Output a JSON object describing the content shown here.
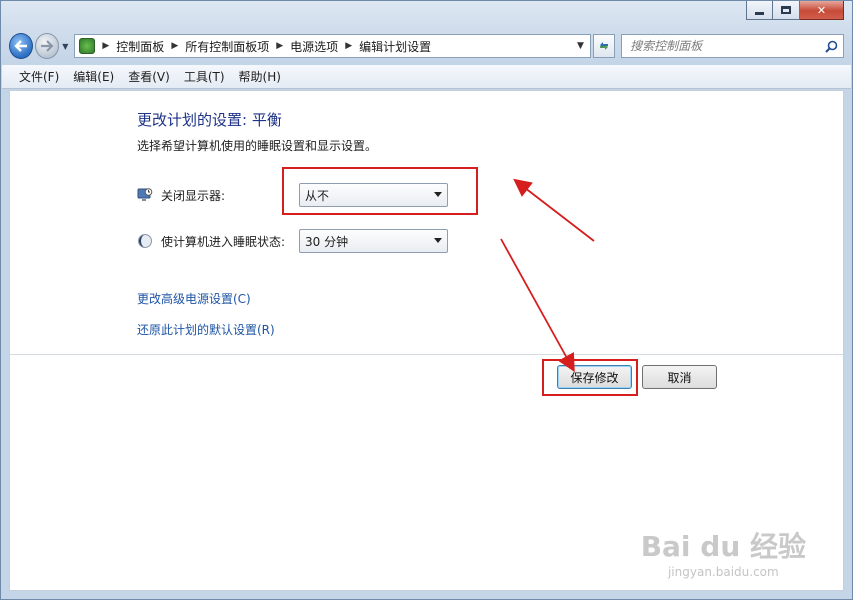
{
  "window": {
    "minimize_label": "",
    "maximize_label": "",
    "close_label": "✕"
  },
  "address_bar": {
    "breadcrumbs": [
      "控制面板",
      "所有控制面板项",
      "电源选项",
      "编辑计划设置"
    ]
  },
  "search": {
    "placeholder": "搜索控制面板"
  },
  "menu": {
    "items": [
      "文件(F)",
      "编辑(E)",
      "查看(V)",
      "工具(T)",
      "帮助(H)"
    ]
  },
  "main": {
    "title": "更改计划的设置: 平衡",
    "description": "选择希望计算机使用的睡眠设置和显示设置。",
    "settings": [
      {
        "label": "关闭显示器:",
        "value": "从不",
        "icon": "display-off-icon"
      },
      {
        "label": "使计算机进入睡眠状态:",
        "value": "30 分钟",
        "icon": "sleep-moon-icon"
      }
    ],
    "links": {
      "advanced": "更改高级电源设置(C)",
      "restore": "还原此计划的默认设置(R)"
    },
    "buttons": {
      "save": "保存修改",
      "cancel": "取消"
    }
  },
  "annotation": {
    "color": "#d61e1e"
  },
  "watermark": {
    "logo_text": "Bai du 经验",
    "url": "jingyan.baidu.com"
  }
}
